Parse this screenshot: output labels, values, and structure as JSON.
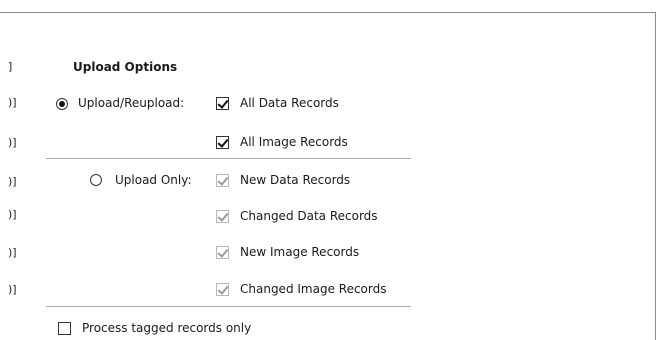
{
  "section": {
    "title": "Upload Options"
  },
  "edge_marks": [
    "]",
    ")]",
    ")]",
    ")]",
    ")]",
    ")]",
    ")]"
  ],
  "options": {
    "reupload": {
      "label": "Upload/Reupload:",
      "selected": true,
      "checks": [
        {
          "label": "All Data Records",
          "checked": true,
          "enabled": true
        },
        {
          "label": "All Image Records",
          "checked": true,
          "enabled": true
        }
      ]
    },
    "upload_only": {
      "label": "Upload Only:",
      "selected": false,
      "checks": [
        {
          "label": "New Data Records",
          "checked": true,
          "enabled": false
        },
        {
          "label": "Changed Data Records",
          "checked": true,
          "enabled": false
        },
        {
          "label": "New Image Records",
          "checked": true,
          "enabled": false
        },
        {
          "label": "Changed Image Records",
          "checked": true,
          "enabled": false
        }
      ]
    }
  },
  "tagged_only": {
    "label": "Process tagged records only",
    "checked": false
  }
}
